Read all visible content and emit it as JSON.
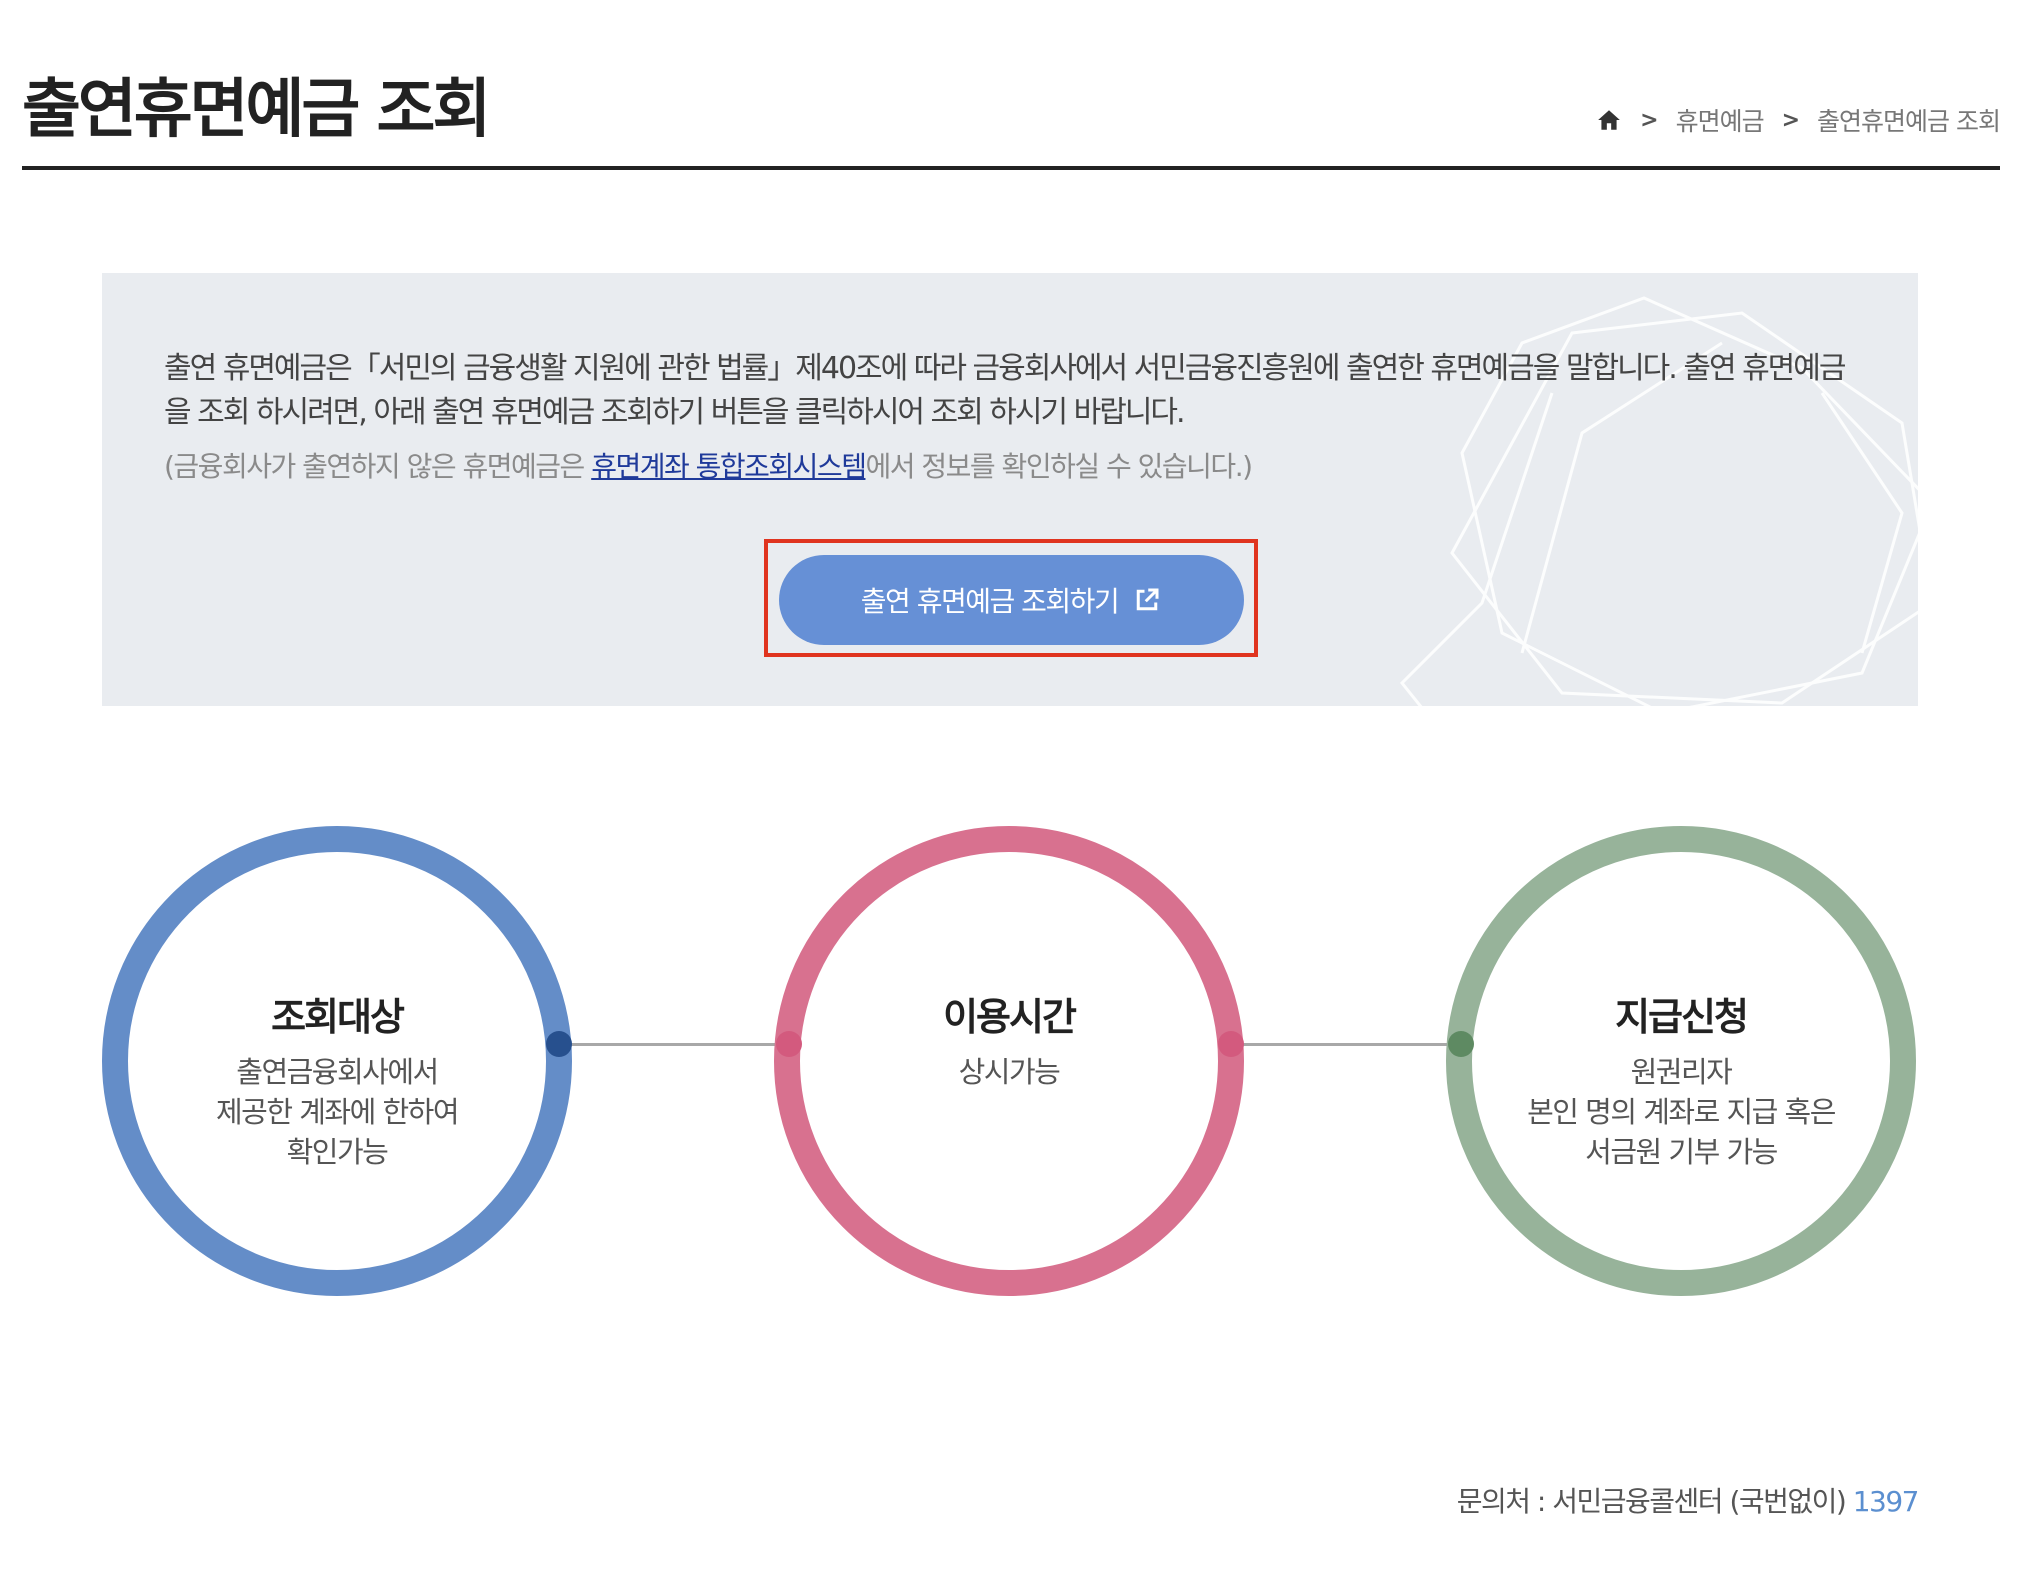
{
  "page": {
    "title": "출연휴면예금 조회"
  },
  "breadcrumb": {
    "home_icon": "home-icon",
    "items": [
      "휴면예금",
      "출연휴면예금 조회"
    ],
    "separator": ">"
  },
  "info": {
    "description": "출연 휴면예금은「서민의 금융생활 지원에 관한 법률」제40조에 따라 금융회사에서 서민금융진흥원에 출연한 휴면예금을 말합니다. 출연 휴면예금을 조회 하시려면, 아래 출연 휴면예금 조회하기 버튼을 클릭하시어 조회 하시기 바랍니다.",
    "note_prefix": "(금융회사가 출연하지 않은 휴면예금은 ",
    "note_link": "휴면계좌 통합조회시스템",
    "note_suffix": "에서 정보를 확인하실 수 있습니다.)",
    "button_label": "출연 휴면예금 조회하기",
    "button_icon": "external-link-icon"
  },
  "steps": [
    {
      "title": "조회대상",
      "lines": [
        "출연금융회사에서",
        "제공한 계좌에 한하여",
        "확인가능"
      ],
      "color": "#648dc8"
    },
    {
      "title": "이용시간",
      "lines": [
        "상시가능"
      ],
      "color": "#d8718f"
    },
    {
      "title": "지급신청",
      "lines": [
        "원권리자",
        "본인 명의 계좌로 지급 혹은",
        "서금원 기부 가능"
      ],
      "color": "#97b39a"
    }
  ],
  "footer": {
    "contact_label": "문의처 : 서민금융콜센터 (국번없이)",
    "contact_number": "1397"
  },
  "colors": {
    "button": "#6690d6",
    "highlight": "#e0341f",
    "link": "#1f3a9a"
  }
}
